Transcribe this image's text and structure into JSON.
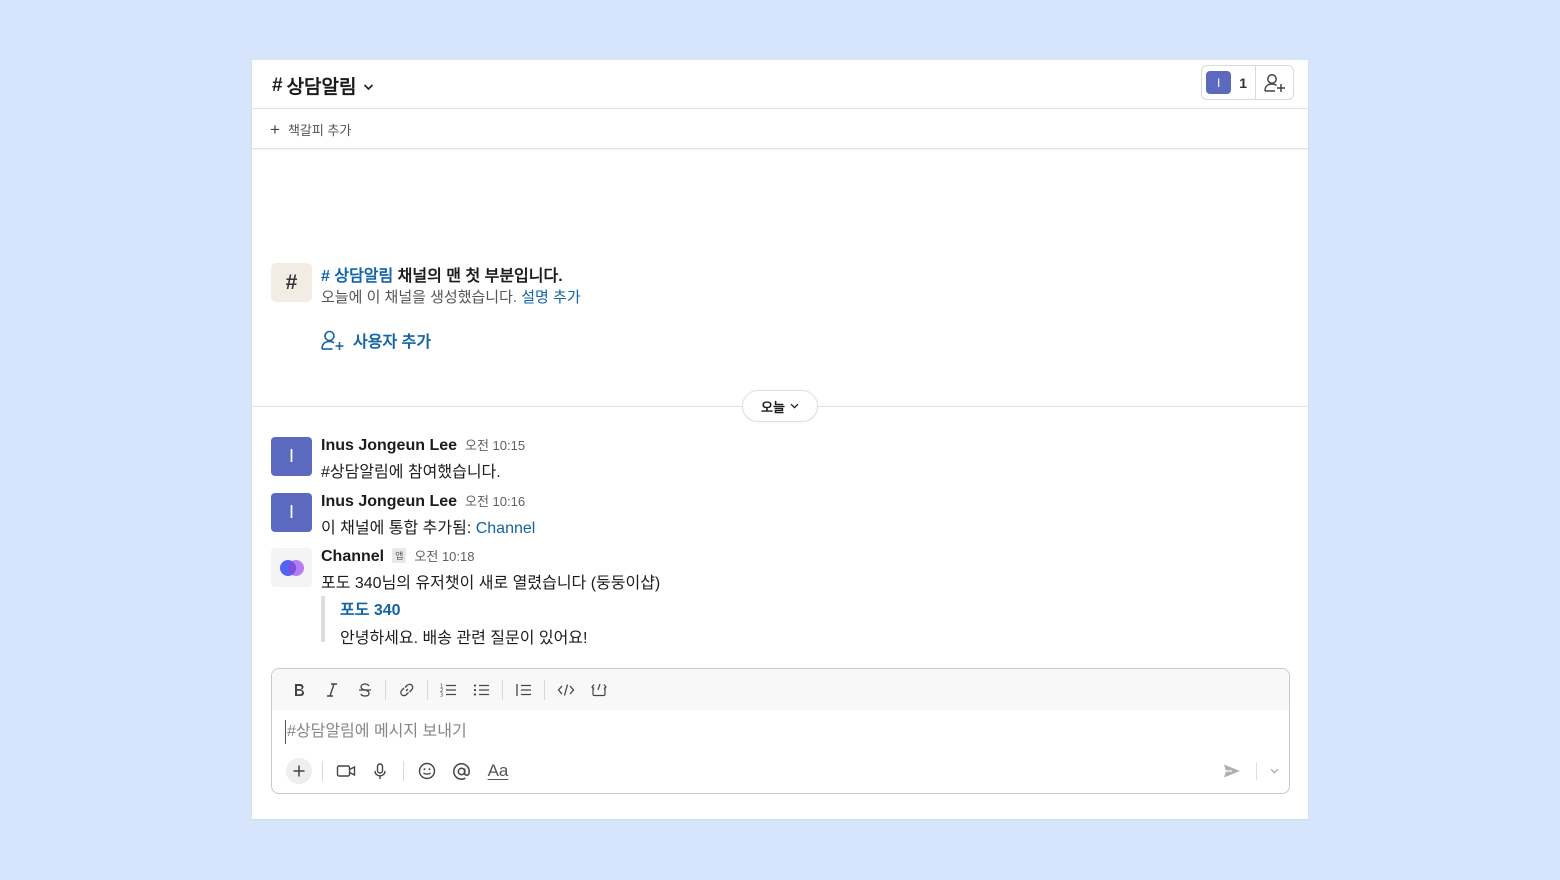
{
  "header": {
    "hash": "#",
    "channel_name": "상담알림",
    "member_avatar_initial": "I",
    "member_count": "1"
  },
  "bookmarks": {
    "add_label": "책갈피 추가"
  },
  "intro": {
    "icon": "#",
    "channel_link": "# 상담알림",
    "title_rest": " 채널의 맨 첫 부분입니다.",
    "subtitle": "오늘에 이 채널을 생성했습니다. ",
    "add_description": "설명 추가",
    "add_people": "사용자 추가"
  },
  "divider": {
    "date_label": "오늘"
  },
  "messages": [
    {
      "avatar_initial": "I",
      "sender": "Inus Jongeun Lee",
      "time": "오전 10:15",
      "text": "#상담알림에 참여했습니다."
    },
    {
      "avatar_initial": "I",
      "sender": "Inus Jongeun Lee",
      "time": "오전 10:16",
      "text": "이 채널에 통합 추가됨: ",
      "link": "Channel"
    },
    {
      "sender": "Channel",
      "app_badge": "앱",
      "time": "오전 10:18",
      "text": "포도 340님의 유저챗이 새로 열렸습니다 (둥둥이샵)",
      "attachment_title": "포도 340",
      "attachment_text": "안녕하세요. 배송 관련 질문이 있어요!"
    }
  ],
  "composer": {
    "placeholder": "#상담알림에 메시지 보내기",
    "format_label": "Aa",
    "format_buttons": [
      "bold-icon",
      "italic-icon",
      "strikethrough-icon",
      "link-icon",
      "ordered-list-icon",
      "bullet-list-icon",
      "blockquote-icon",
      "code-icon",
      "code-block-icon"
    ],
    "bottom_buttons": [
      "plus-icon",
      "video-icon",
      "microphone-icon",
      "emoji-icon",
      "mention-icon",
      "text-format-icon"
    ]
  },
  "colors": {
    "background": "#d6e5fc",
    "link": "#1264a3",
    "avatar": "#5b6abf",
    "channel_logo_blue": "#4a5cf0",
    "channel_logo_purple": "#b57cf5"
  }
}
